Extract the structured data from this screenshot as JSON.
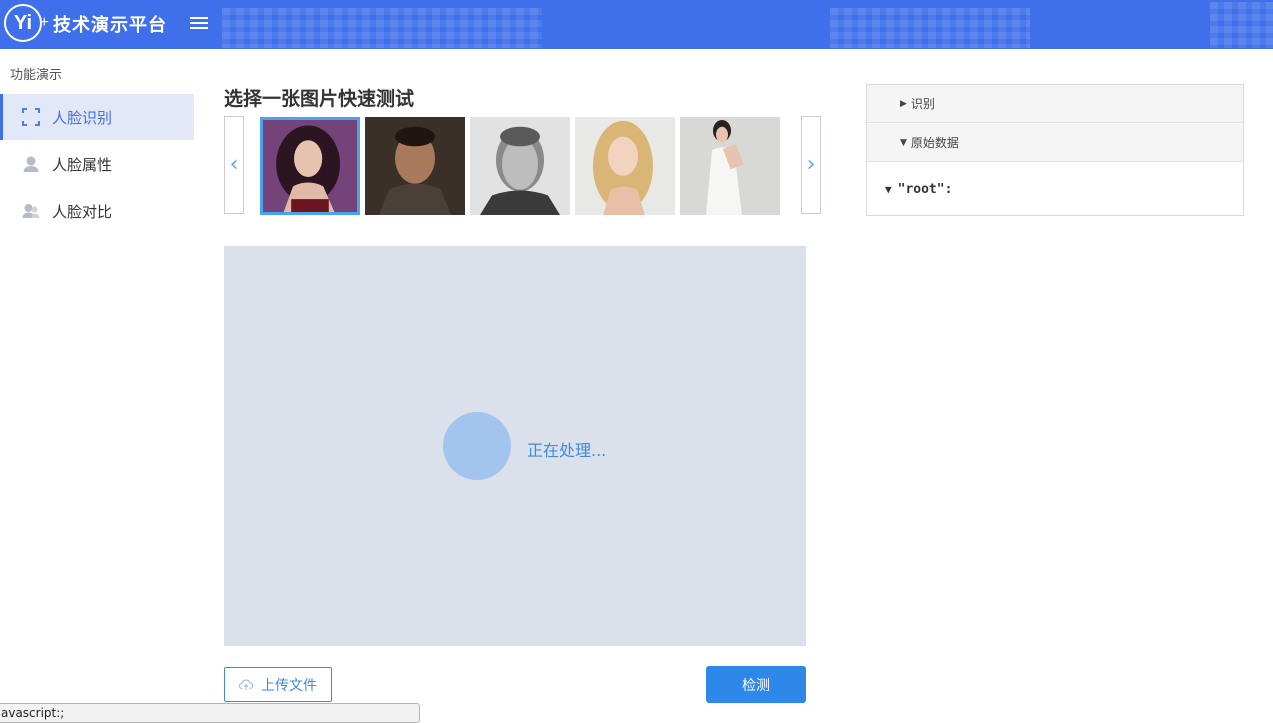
{
  "header": {
    "logo_text": "Yi",
    "logo_plus": "+",
    "title": "技术演示平台",
    "color": "#3f6fea"
  },
  "sidebar": {
    "section_title": "功能演示",
    "items": [
      {
        "label": "人脸识别",
        "icon": "face-scan-icon",
        "active": true
      },
      {
        "label": "人脸属性",
        "icon": "user-icon",
        "active": false
      },
      {
        "label": "人脸对比",
        "icon": "users-icon",
        "active": false
      }
    ]
  },
  "main": {
    "title": "选择一张图片快速测试",
    "carousel": {
      "prev_arrow": "‹",
      "next_arrow": "›",
      "thumbnails": [
        {
          "name": "woman-dark-hair-photo",
          "selected": true
        },
        {
          "name": "man-smiling-photo",
          "selected": false
        },
        {
          "name": "man-bw-portrait-photo",
          "selected": false
        },
        {
          "name": "woman-blonde-photo",
          "selected": false
        },
        {
          "name": "woman-white-dress-photo",
          "selected": false
        }
      ]
    },
    "preview": {
      "status_text": "正在处理..."
    },
    "upload_label": "上传文件",
    "detect_label": "检测"
  },
  "panel": {
    "rows": [
      {
        "label": "识别",
        "expanded": false
      },
      {
        "label": "原始数据",
        "expanded": true
      }
    ],
    "json_root": "\"root\":"
  },
  "statusbar": {
    "text": "avascript:;"
  }
}
